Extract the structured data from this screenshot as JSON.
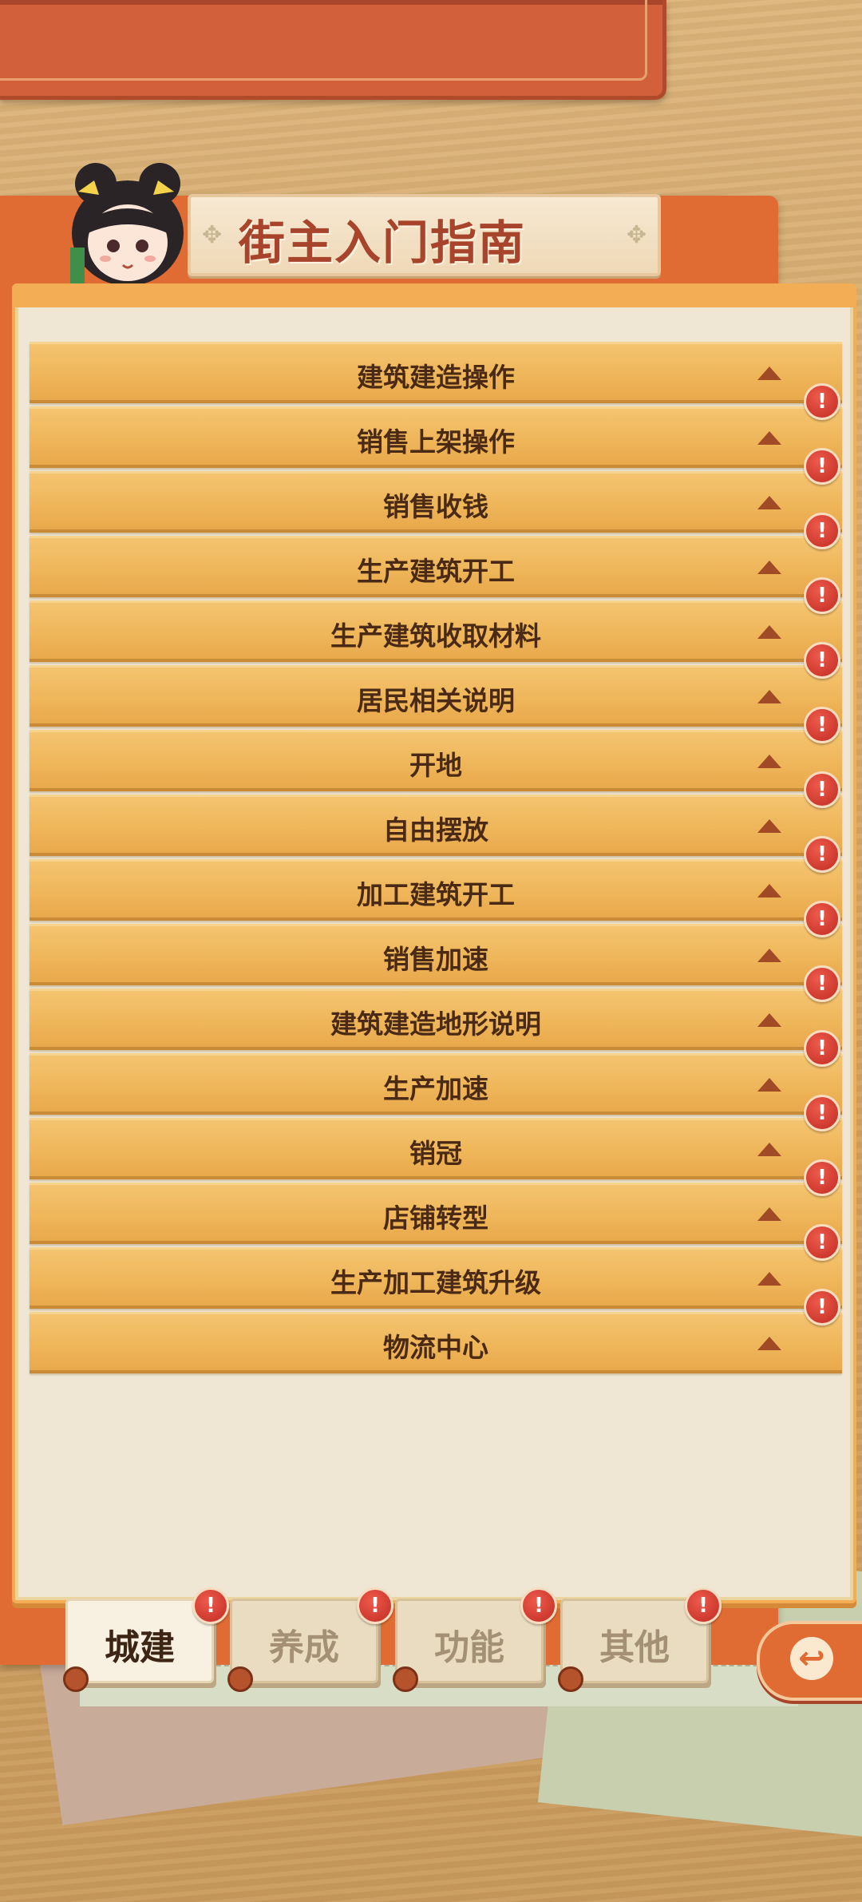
{
  "title": "街主入门指南",
  "title_deco": "✥",
  "items": [
    {
      "label": "建筑建造操作",
      "badge": false
    },
    {
      "label": "销售上架操作",
      "badge": true
    },
    {
      "label": "销售收钱",
      "badge": true
    },
    {
      "label": "生产建筑开工",
      "badge": true
    },
    {
      "label": "生产建筑收取材料",
      "badge": true
    },
    {
      "label": "居民相关说明",
      "badge": true
    },
    {
      "label": "开地",
      "badge": true
    },
    {
      "label": "自由摆放",
      "badge": true
    },
    {
      "label": "加工建筑开工",
      "badge": true
    },
    {
      "label": "销售加速",
      "badge": true
    },
    {
      "label": "建筑建造地形说明",
      "badge": true
    },
    {
      "label": "生产加速",
      "badge": true
    },
    {
      "label": "销冠",
      "badge": true
    },
    {
      "label": "店铺转型",
      "badge": true
    },
    {
      "label": "生产加工建筑升级",
      "badge": true
    },
    {
      "label": "物流中心",
      "badge": true
    }
  ],
  "badge_text": "!",
  "tabs": [
    {
      "label": "城建",
      "active": true
    },
    {
      "label": "养成",
      "active": false
    },
    {
      "label": "功能",
      "active": false
    },
    {
      "label": "其他",
      "active": false
    }
  ],
  "back_icon_glyph": "↩",
  "colors": {
    "accent": "#e06b33",
    "row": "#efb65a",
    "badge": "#d23a2e",
    "title_text": "#a8432c"
  }
}
